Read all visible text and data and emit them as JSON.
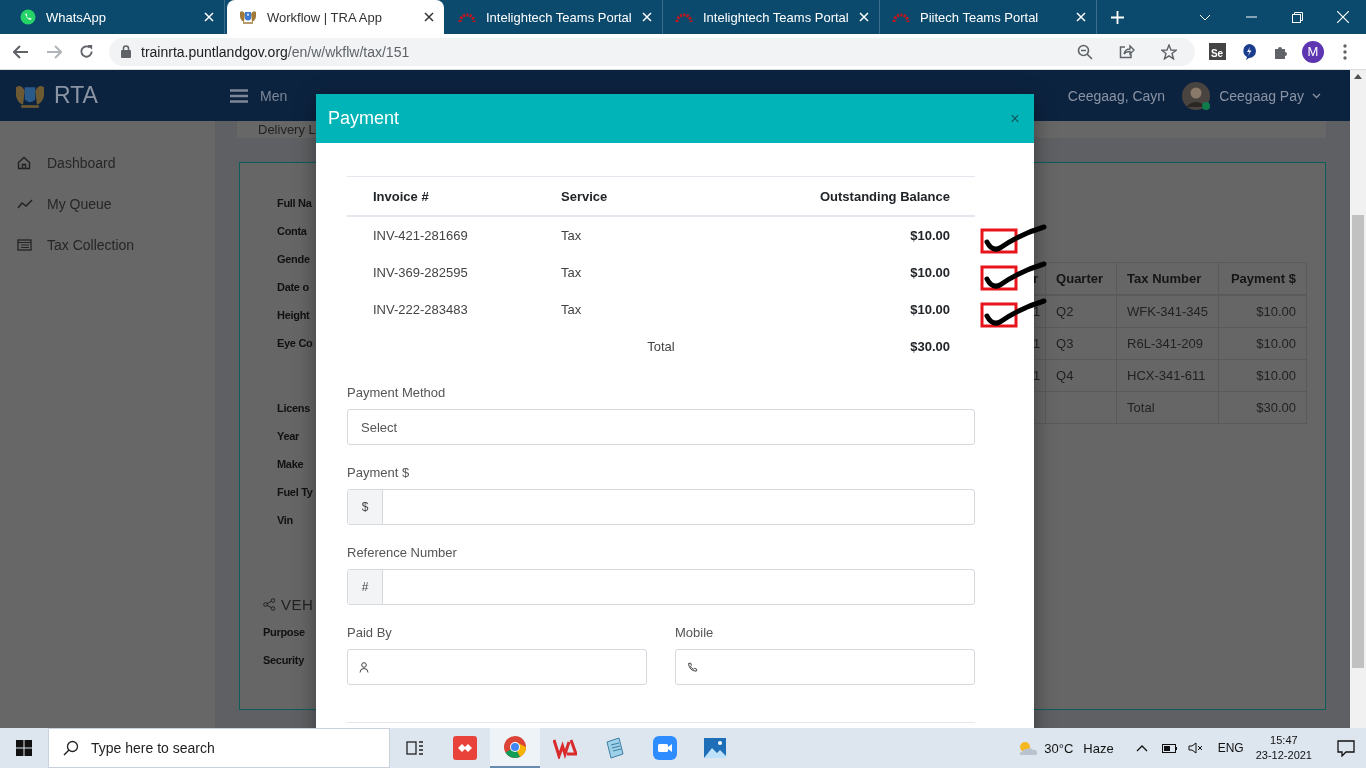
{
  "browser": {
    "tabs": [
      {
        "title": "WhatsApp",
        "kind": "whatsapp",
        "selected": false
      },
      {
        "title": "Workflow | TRA App",
        "kind": "crest",
        "selected": true
      },
      {
        "title": "Intelightech Teams Portal",
        "kind": "arc",
        "selected": false
      },
      {
        "title": "Intelightech Teams Portal",
        "kind": "arc",
        "selected": false
      },
      {
        "title": "Piitech Teams Portal",
        "kind": "arc",
        "selected": false
      }
    ],
    "url": {
      "host": "trainrta.puntlandgov.org",
      "path": "/en/w/wkflw/tax/151"
    },
    "extension_badge": "Se",
    "profile_initial": "M"
  },
  "header": {
    "brand": "RTA",
    "menu": "Men",
    "user_name": "Ceegaag, Cayn",
    "account": "Ceegaag Pay"
  },
  "sidebar": {
    "items": [
      {
        "label": "Dashboard",
        "kind": "home"
      },
      {
        "label": "My Queue",
        "kind": "trend"
      },
      {
        "label": "Tax Collection",
        "kind": "list"
      }
    ]
  },
  "page": {
    "top_card": "Delivery L",
    "label_groups": [
      [
        "Full Na",
        "Conta",
        "Gende",
        "Date o",
        "Height",
        "Eye Co"
      ],
      [
        "Licens",
        "Year",
        "Make",
        "Fuel Ty",
        "Vin"
      ]
    ],
    "section_title": "VEH",
    "section_labels": [
      "Purpose",
      "Security"
    ],
    "table": {
      "columns": [
        "r",
        "Quarter",
        "Tax Number",
        "Payment $"
      ],
      "rows": [
        [
          "1",
          "Q2",
          "WFK-341-345",
          "$10.00"
        ],
        [
          "1",
          "Q3",
          "R6L-341-209",
          "$10.00"
        ],
        [
          "1",
          "Q4",
          "HCX-341-611",
          "$10.00"
        ]
      ],
      "total_label": "Total",
      "total": "$30.00"
    }
  },
  "modal": {
    "title": "Payment",
    "close": "×",
    "columns": [
      "Invoice #",
      "Service",
      "Outstanding Balance"
    ],
    "invoices": [
      {
        "invoice": "INV-421-281669",
        "service": "Tax",
        "balance": "$10.00",
        "checked": true
      },
      {
        "invoice": "INV-369-282595",
        "service": "Tax",
        "balance": "$10.00",
        "checked": true
      },
      {
        "invoice": "INV-222-283483",
        "service": "Tax",
        "balance": "$10.00",
        "checked": true
      }
    ],
    "total_label": "Total",
    "total": "$30.00",
    "field_rows": [
      [
        {
          "label": "Payment Method",
          "kind": "select",
          "value": "Select"
        }
      ],
      [
        {
          "label": "Payment $",
          "kind": "addon",
          "addon": "$"
        }
      ],
      [
        {
          "label": "Reference Number",
          "kind": "addon",
          "addon": "#"
        }
      ],
      [
        {
          "label": "Paid By",
          "kind": "person"
        },
        {
          "label": "Mobile",
          "kind": "phone"
        }
      ]
    ]
  },
  "taskbar": {
    "search_placeholder": "Type here to search",
    "apps": [
      {
        "kind": "taskview",
        "selected": false
      },
      {
        "kind": "redapp",
        "selected": false
      },
      {
        "kind": "chrome",
        "selected": true
      },
      {
        "kind": "wps",
        "selected": false
      },
      {
        "kind": "notes",
        "selected": false
      },
      {
        "kind": "zoom",
        "selected": false
      },
      {
        "kind": "photos",
        "selected": false
      }
    ],
    "weather": {
      "temp": "30°C",
      "condition": "Haze"
    },
    "language": "ENG",
    "time": "15:47",
    "date": "23-12-2021"
  }
}
